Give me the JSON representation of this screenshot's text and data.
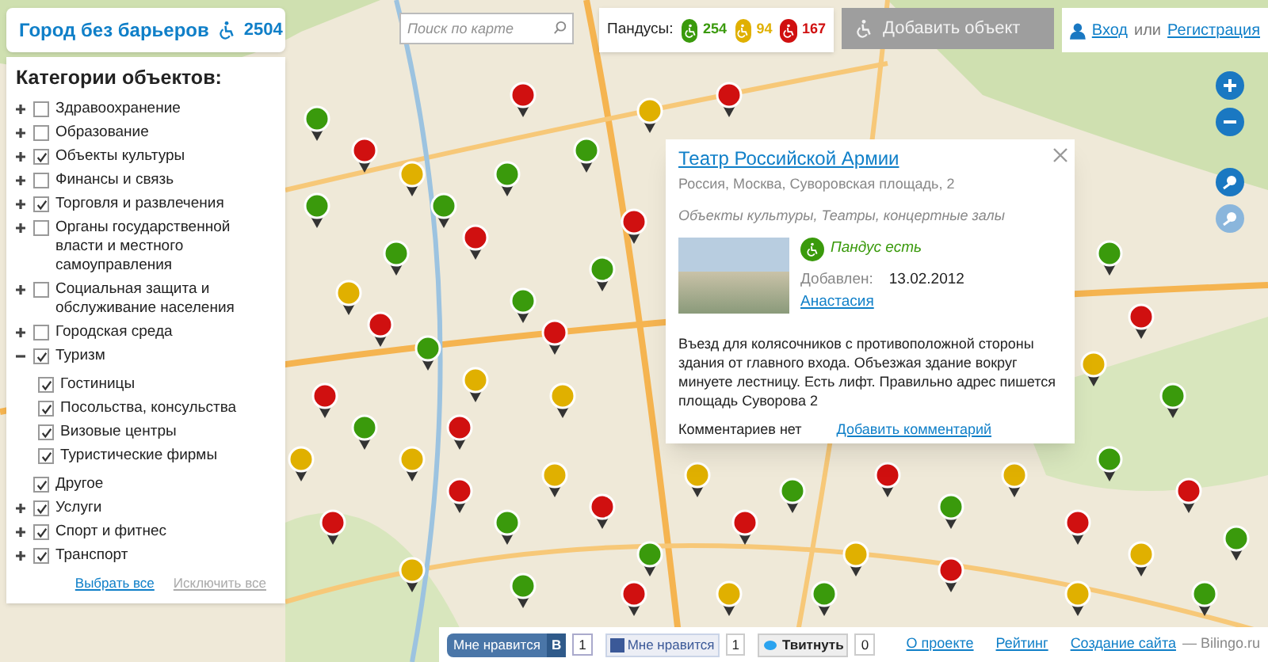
{
  "header": {
    "title": "Город без барьеров",
    "count": "2504"
  },
  "search": {
    "placeholder": "Поиск по карте"
  },
  "ramps": {
    "label": "Пандусы:",
    "items": [
      {
        "count": "254",
        "color": "#3a9a0c"
      },
      {
        "count": "94",
        "color": "#e0b000"
      },
      {
        "count": "167",
        "color": "#d01010"
      }
    ]
  },
  "add_button": {
    "label": "Добавить объект",
    "disabled": true
  },
  "auth": {
    "login": "Вход",
    "or": "или",
    "register": "Регистрация"
  },
  "sidebar": {
    "title": "Категории объектов:",
    "items": [
      {
        "label": "Здравоохранение",
        "checked": false,
        "expanded": false
      },
      {
        "label": "Образование",
        "checked": false,
        "expanded": false
      },
      {
        "label": "Объекты культуры",
        "checked": true,
        "expanded": false
      },
      {
        "label": "Финансы и связь",
        "checked": false,
        "expanded": false
      },
      {
        "label": "Торговля и развлечения",
        "checked": true,
        "expanded": false
      },
      {
        "label": "Органы государственной власти и местного самоуправления",
        "checked": false,
        "expanded": false
      },
      {
        "label": "Социальная защита и обслуживание населения",
        "checked": false,
        "expanded": false
      },
      {
        "label": "Городская среда",
        "checked": false,
        "expanded": false
      },
      {
        "label": "Туризм",
        "checked": true,
        "expanded": true,
        "children": [
          {
            "label": "Гостиницы",
            "checked": true
          },
          {
            "label": "Посольства, консульства",
            "checked": true
          },
          {
            "label": "Визовые центры",
            "checked": true
          },
          {
            "label": "Туристические фирмы",
            "checked": true
          }
        ]
      },
      {
        "label": "Другое",
        "checked": true
      },
      {
        "label": "Услуги",
        "checked": true,
        "expanded": false
      },
      {
        "label": "Спорт и фитнес",
        "checked": true,
        "expanded": false
      },
      {
        "label": "Транспорт",
        "checked": true,
        "expanded": false
      }
    ],
    "select_all": "Выбрать все",
    "exclude_all": "Исключить все"
  },
  "popup": {
    "title": "Театр Российской Армии",
    "address": "Россия, Москва, Суворовская площадь, 2",
    "categories": "Объекты культуры, Театры, концертные залы",
    "ramp": {
      "status": "Пандус есть",
      "color": "#3a9a0c"
    },
    "added_label": "Добавлен:",
    "added_date": "13.02.2012",
    "author": "Анастасия",
    "description": "Въезд для колясочников с противоположной стороны здания от главного входа. Объезжая здание вокруг минуете лестницу. Есть лифт. Правильно адрес пишется площадь Суворова 2",
    "comments": "Комментариев нет",
    "add_comment": "Добавить комментарий"
  },
  "footer": {
    "vk_like": "Мне нравится",
    "vk_letter": "В",
    "vk_count": "1",
    "fb_like": "Мне нравится",
    "fb_count": "1",
    "tweet": "Твитнуть",
    "tweet_count": "0",
    "links": [
      "О проекте",
      "Рейтинг",
      "Создание сайта"
    ],
    "credit": "— Bilingo.ru"
  }
}
